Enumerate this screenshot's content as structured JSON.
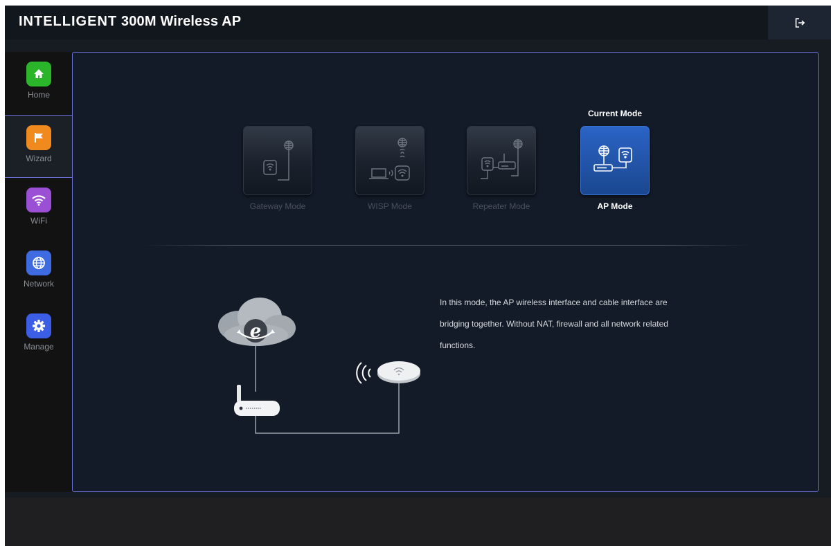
{
  "header": {
    "brand": "INTELLIGENT",
    "product": "300M Wireless AP",
    "logout_icon": "logout-icon"
  },
  "sidebar": {
    "items": [
      {
        "label": "Home",
        "icon": "home-icon",
        "color": "#2bb52b"
      },
      {
        "label": "Wizard",
        "icon": "flag-icon",
        "color": "#f08a1e",
        "active": true
      },
      {
        "label": "WiFi",
        "icon": "wifi-icon",
        "color": "#9b4fd4"
      },
      {
        "label": "Network",
        "icon": "globe-icon",
        "color": "#3e6be0"
      },
      {
        "label": "Manage",
        "icon": "gear-icon",
        "color": "#3c5ee6"
      }
    ]
  },
  "modes": {
    "current_label": "Current Mode",
    "items": [
      {
        "label": "Gateway Mode",
        "current": false
      },
      {
        "label": "WISP Mode",
        "current": false
      },
      {
        "label": "Repeater Mode",
        "current": false
      },
      {
        "label": "AP Mode",
        "current": true
      }
    ]
  },
  "description": "In this mode, the AP wireless interface and cable interface are bridging together. Without NAT, firewall and all network related functions.",
  "colors": {
    "accent_border": "#6a6fd6",
    "current_mode_tile": "#2459b5",
    "panel_bg": "#131b28"
  }
}
